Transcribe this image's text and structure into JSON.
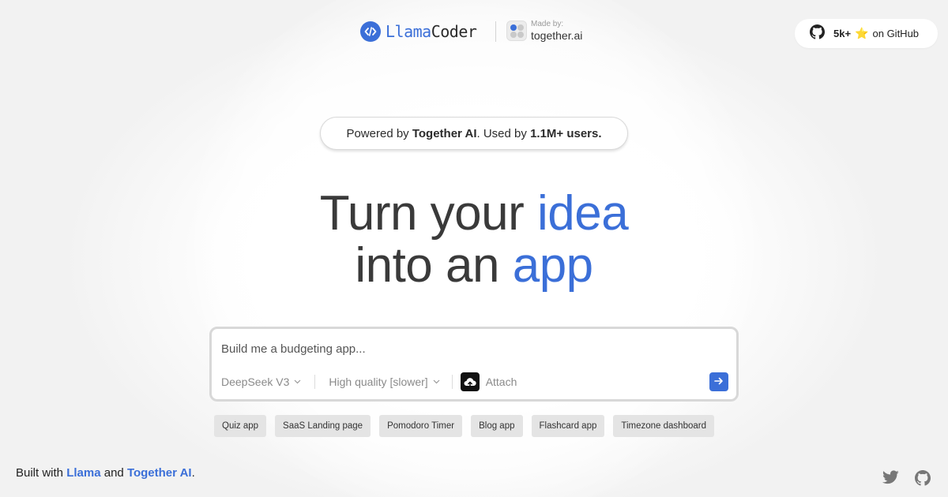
{
  "header": {
    "brand_llama": "Llama",
    "brand_coder": "Coder",
    "made_by": "Made by:",
    "partner": "together.ai",
    "github": {
      "count": "5k+",
      "star": "⭐",
      "label": "on GitHub"
    }
  },
  "badge": {
    "pre": "Powered by ",
    "company": "Together AI",
    "mid": ". Used by ",
    "users": "1.1M+ users."
  },
  "headline": {
    "line1_pre": "Turn your ",
    "line1_accent": "idea",
    "line2_pre": "into an ",
    "line2_accent": "app"
  },
  "prompt": {
    "placeholder": "Build me a budgeting app...",
    "model": "DeepSeek V3",
    "quality": "High quality [slower]",
    "attach": "Attach"
  },
  "chips": [
    "Quiz app",
    "SaaS Landing page",
    "Pomodoro Timer",
    "Blog app",
    "Flashcard app",
    "Timezone dashboard"
  ],
  "footer": {
    "pre": "Built with ",
    "llama": "Llama",
    "and": " and ",
    "together": "Together AI",
    "post": "."
  },
  "colors": {
    "accent": "#3b6fd8",
    "page_bg": "#f3f3f3",
    "chip_bg": "#e4e4e4"
  },
  "icons": [
    "code-brackets-icon",
    "together-logo-icon",
    "github-icon",
    "star-icon",
    "chevron-down-icon",
    "upload-cloud-icon",
    "arrow-right-icon",
    "twitter-icon"
  ]
}
